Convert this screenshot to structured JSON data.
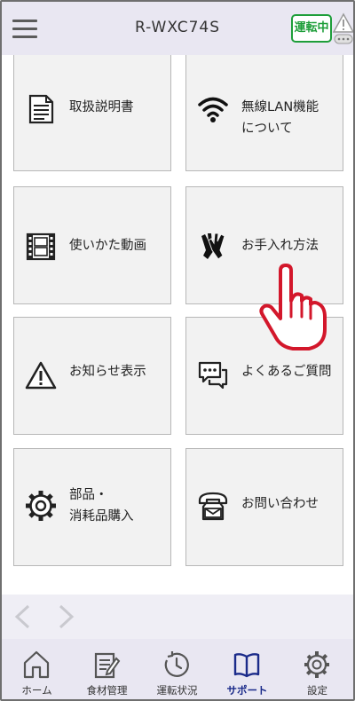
{
  "header": {
    "title": "R-WXC74S",
    "run_status": "運転中"
  },
  "tiles": [
    {
      "label": "取扱説明書",
      "icon": "document-icon"
    },
    {
      "label": "無線LAN機能\nについて",
      "icon": "wifi-icon"
    },
    {
      "label": "使いかた動画",
      "icon": "film-icon"
    },
    {
      "label": "お手入れ方法",
      "icon": "gloves-icon"
    },
    {
      "label": "お知らせ表示",
      "icon": "warning-icon"
    },
    {
      "label": "よくあるご質問",
      "icon": "chat-icon"
    },
    {
      "label": "部品・\n消耗品購入",
      "icon": "gear-icon"
    },
    {
      "label": "お問い合わせ",
      "icon": "phone-icon"
    }
  ],
  "nav": [
    {
      "label": "ホーム",
      "icon": "home-icon"
    },
    {
      "label": "食材管理",
      "icon": "notepad-icon"
    },
    {
      "label": "運転状況",
      "icon": "clock-icon"
    },
    {
      "label": "サポート",
      "icon": "book-icon",
      "active": true
    },
    {
      "label": "設定",
      "icon": "settings-icon"
    }
  ],
  "colors": {
    "header_bg": "#e9e7f2",
    "run_green": "#1e9e3a",
    "active_nav": "#1b2b8a",
    "pointer_red": "#d3172b"
  }
}
